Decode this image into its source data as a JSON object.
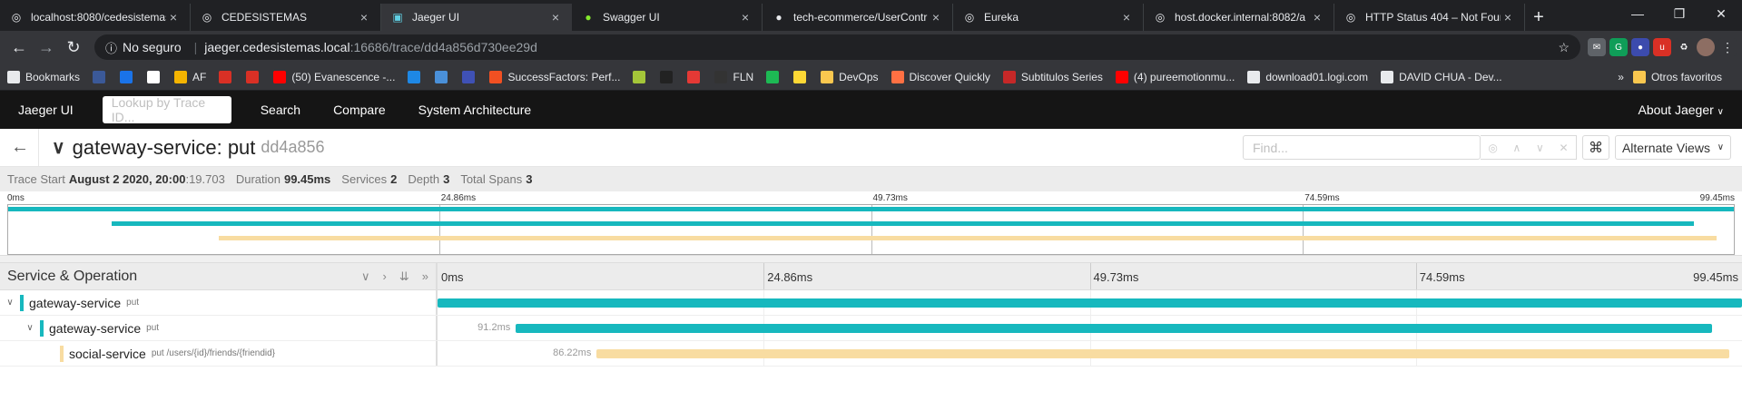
{
  "browser": {
    "tabs": [
      {
        "title": "localhost:8080/cedesistemas",
        "favicon": "globe-icon"
      },
      {
        "title": "CEDESISTEMAS",
        "favicon": "globe-icon"
      },
      {
        "title": "Jaeger UI",
        "favicon": "jaeger-icon",
        "active": true
      },
      {
        "title": "Swagger UI",
        "favicon": "swagger-icon"
      },
      {
        "title": "tech-ecommerce/UserContr",
        "favicon": "github-icon"
      },
      {
        "title": "Eureka",
        "favicon": "globe-icon"
      },
      {
        "title": "host.docker.internal:8082/a",
        "favicon": "globe-icon"
      },
      {
        "title": "HTTP Status 404 – Not Foun",
        "favicon": "globe-icon"
      }
    ],
    "security_label": "No seguro",
    "url_host": "jaeger.cedesistemas.local",
    "url_path": ":16686/trace/dd4a856d730ee29d",
    "bookmarks": [
      "Bookmarks",
      "",
      "",
      "",
      "AF",
      "",
      "",
      "(50) Evanescence -...",
      "",
      "",
      "",
      "SuccessFactors: Perf...",
      "",
      "",
      "",
      "FLN",
      "",
      "",
      "DevOps",
      "Discover Quickly",
      "Subtitulos Series",
      "(4) pureemotionmu...",
      "download01.logi.com",
      "DAVID CHUA - Dev..."
    ],
    "other_bookmarks": "Otros favoritos",
    "more": "»"
  },
  "jaeger_nav": {
    "brand": "Jaeger UI",
    "lookup_placeholder": "Lookup by Trace ID...",
    "links": [
      "Search",
      "Compare",
      "System Architecture"
    ],
    "about": "About Jaeger"
  },
  "trace": {
    "title": "gateway-service: put",
    "trace_id": "dd4a856",
    "find_placeholder": "Find...",
    "alternate_views": "Alternate Views",
    "meta": {
      "trace_start_label": "Trace Start",
      "trace_start_date": "August 2 2020, 20:00",
      "trace_start_ms": ":19.703",
      "duration_label": "Duration",
      "duration": "99.45ms",
      "services_label": "Services",
      "services": "2",
      "depth_label": "Depth",
      "depth": "3",
      "total_spans_label": "Total Spans",
      "total_spans": "3"
    },
    "ticks": [
      "0ms",
      "24.86ms",
      "49.73ms",
      "74.59ms",
      "99.45ms"
    ],
    "span_header": "Service & Operation",
    "spans": [
      {
        "service": "gateway-service",
        "operation": "put",
        "color": "#17b8be",
        "start": 0.0,
        "end": 1.0,
        "duration": "",
        "depth": 0
      },
      {
        "service": "gateway-service",
        "operation": "put",
        "color": "#17b8be",
        "start": 0.06,
        "end": 0.977,
        "duration": "91.2ms",
        "depth": 1
      },
      {
        "service": "social-service",
        "operation": "put /users/{id}/friends/{friendid}",
        "color": "#f8dcA1",
        "start": 0.122,
        "end": 0.99,
        "duration": "86.22ms",
        "depth": 2
      }
    ]
  }
}
